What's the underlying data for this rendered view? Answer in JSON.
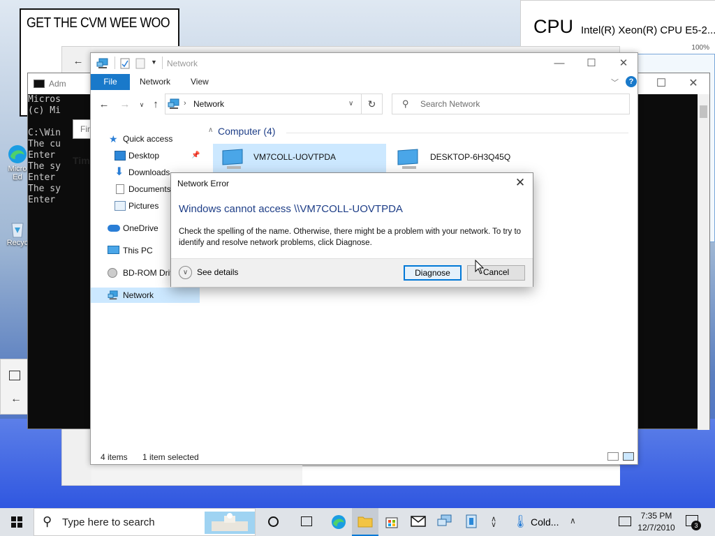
{
  "sticky_note": {
    "text": "GET THE CVM WEE WOO"
  },
  "task_manager": {
    "heading": "CPU",
    "model": "Intel(R) Xeon(R) CPU E5-2...",
    "max_label": "100%"
  },
  "settings_window": {
    "search_placeholder": "Fir",
    "section_label": "Time"
  },
  "cmd_window": {
    "title": "Adm",
    "lines": [
      "Micros",
      "(c) Mi",
      "",
      "C:\\Win",
      "The cu",
      "Enter ",
      "The sy",
      "Enter ",
      "The sy",
      "Enter "
    ]
  },
  "desktop_icons": {
    "edge_label_1": "Micro",
    "edge_label_2": "Ed",
    "recycle_label": "Recyc"
  },
  "explorer": {
    "title": "Network",
    "ribbon": {
      "file": "File",
      "tabs": [
        "Network",
        "View"
      ]
    },
    "address": "Network",
    "search_placeholder": "Search Network",
    "nav": {
      "quick_access": "Quick access",
      "desktop": "Desktop",
      "downloads": "Downloads",
      "documents": "Documents",
      "pictures": "Pictures",
      "onedrive": "OneDrive",
      "this_pc": "This PC",
      "bd_rom": "BD-ROM Drive",
      "network": "Network"
    },
    "group_header": "Computer (4)",
    "computers": [
      "VM7COLL-UOVTPDA",
      "DESKTOP-6H3Q45Q"
    ],
    "status": {
      "items": "4 items",
      "selected": "1 item selected"
    }
  },
  "dialog": {
    "title": "Network Error",
    "heading": "Windows cannot access \\\\VM7COLL-UOVTPDA",
    "body": "Check the spelling of the name. Otherwise, there might be a problem with your network. To try to identify and resolve network problems, click Diagnose.",
    "see_details": "See details",
    "diagnose": "Diagnose",
    "cancel": "Cancel"
  },
  "taskbar": {
    "search_placeholder": "Type here to search",
    "weather": "Cold...",
    "time": "7:35 PM",
    "date": "12/7/2010",
    "notification_count": "3"
  },
  "colors": {
    "accent": "#0078d7",
    "file_tab": "#1979ca",
    "heading_blue": "#1e3e87",
    "selection": "#cce8ff"
  }
}
